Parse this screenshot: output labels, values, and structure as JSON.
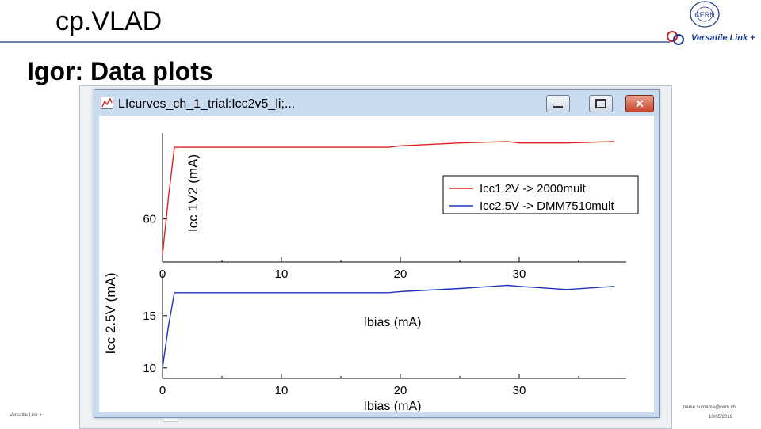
{
  "slide": {
    "title": "cp.VLAD",
    "subtitle": "Igor: Data plots",
    "logo_text": "Versatile Link +",
    "cern_text": "CERN",
    "footer_left": "Versatile Link +",
    "footer_email": "name.surname@cern.ch",
    "footer_date": "10/05/2019"
  },
  "window": {
    "title": "LIcurves_ch_1_trial:Icc2v5_li;...",
    "icons": {
      "app": "graph-icon",
      "minimize": "minimize-icon",
      "maximize": "maximize-icon",
      "close": "close-icon"
    },
    "close_glyph": "✕"
  },
  "chart_data": [
    {
      "type": "line",
      "xlabel": "Ibias (mA)",
      "ylabel": "Icc 1V2 (mA)",
      "xlim": [
        0,
        39
      ],
      "ylim": [
        54,
        72
      ],
      "xticks": [
        0,
        10,
        20,
        30
      ],
      "yticks": [
        60
      ],
      "series": [
        {
          "name": "Icc1.2V -> 2000mult",
          "color": "#e02020",
          "x": [
            0,
            0.5,
            1,
            5,
            10,
            19,
            20,
            25,
            29,
            30,
            34,
            38
          ],
          "y": [
            55,
            63,
            70,
            70,
            70,
            70,
            70.2,
            70.6,
            70.8,
            70.6,
            70.6,
            70.8
          ]
        }
      ],
      "legend": {
        "placement": "right",
        "entries": [
          "Icc1.2V -> 2000mult",
          "Icc2.5V -> DMM7510mult"
        ]
      }
    },
    {
      "type": "line",
      "xlabel": "Ibias (mA)",
      "ylabel": "Icc 2.5V (mA)",
      "xlim": [
        0,
        39
      ],
      "ylim": [
        9,
        19
      ],
      "xticks": [
        0,
        10,
        20,
        30
      ],
      "yticks": [
        10,
        15
      ],
      "series": [
        {
          "name": "Icc2.5V -> DMM7510mult",
          "color": "#2030c0",
          "x": [
            0,
            0.5,
            1,
            5,
            10,
            19,
            20,
            25,
            29,
            30,
            34,
            38
          ],
          "y": [
            10,
            14,
            17.2,
            17.2,
            17.2,
            17.2,
            17.3,
            17.6,
            17.9,
            17.8,
            17.5,
            17.8
          ]
        }
      ]
    }
  ],
  "tick_text": {
    "top_x": [
      "0",
      "10",
      "20",
      "30"
    ],
    "top_y": [
      "60"
    ],
    "bottom_x": [
      "0",
      "10",
      "20",
      "30"
    ],
    "bottom_y": [
      "10",
      "15"
    ]
  }
}
